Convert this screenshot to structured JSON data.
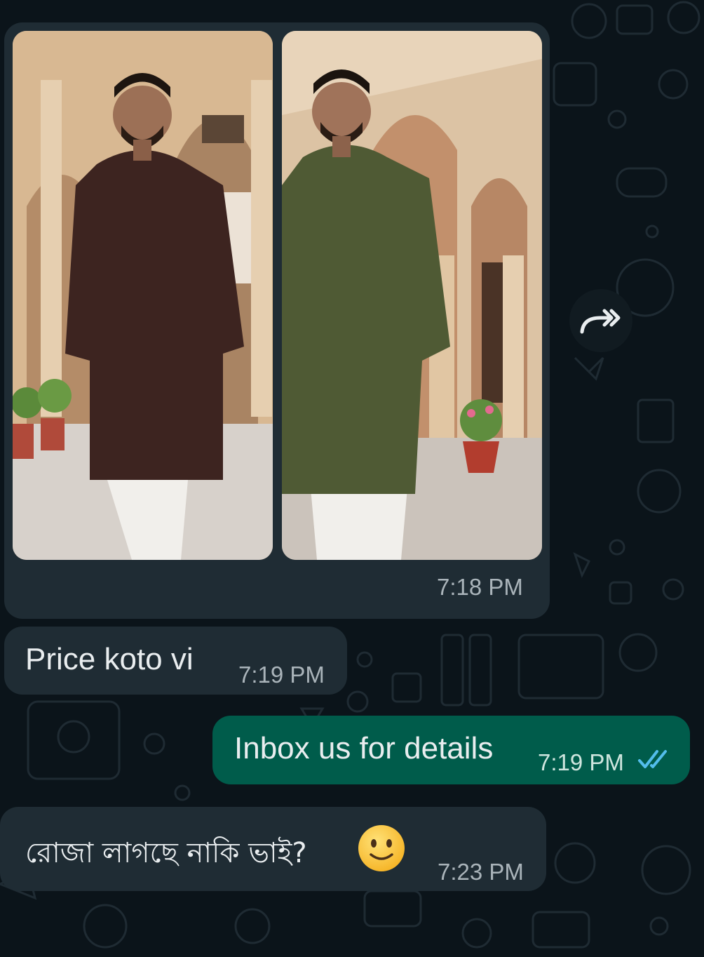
{
  "messages": [
    {
      "type": "media",
      "direction": "incoming",
      "images": [
        {
          "alt": "model in dark brown panjabi with white pajama"
        },
        {
          "alt": "model in olive green panjabi with white pajama"
        }
      ],
      "time": "7:18 PM"
    },
    {
      "type": "text",
      "direction": "incoming",
      "text": "Price koto vi",
      "time": "7:19 PM"
    },
    {
      "type": "text",
      "direction": "outgoing",
      "text": "Inbox us for details",
      "time": "7:19 PM",
      "status": "read"
    },
    {
      "type": "text",
      "direction": "incoming",
      "text": "রোজা লাগছে নাকি ভাই?",
      "emoji": "slightly-smiling-face",
      "time": "7:23 PM"
    }
  ],
  "forward_button": {
    "icon": "forward-icon"
  },
  "colors": {
    "background": "#0b141a",
    "incoming_bubble": "#1f2c34",
    "outgoing_bubble": "#005c4b",
    "read_ticks": "#53bdeb"
  }
}
